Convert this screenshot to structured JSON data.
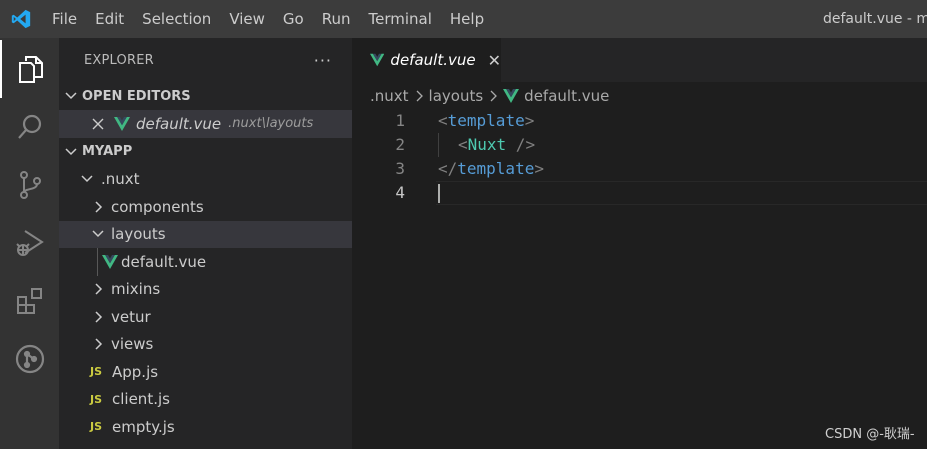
{
  "titlebar": {
    "menu": [
      "File",
      "Edit",
      "Selection",
      "View",
      "Go",
      "Run",
      "Terminal",
      "Help"
    ],
    "window_title": "default.vue - my"
  },
  "activitybar": {
    "icons": [
      "explorer-icon",
      "search-icon",
      "source-control-icon",
      "run-debug-icon",
      "extensions-icon",
      "git-graph-icon"
    ]
  },
  "sidebar": {
    "title": "EXPLORER",
    "more": "···",
    "open_editors": {
      "header": "OPEN EDITORS",
      "items": [
        {
          "name": "default.vue",
          "path": ".nuxt\\layouts"
        }
      ]
    },
    "project": {
      "header": "MYAPP",
      "tree": [
        {
          "label": ".nuxt",
          "kind": "folder-open",
          "level": 1
        },
        {
          "label": "components",
          "kind": "folder",
          "level": 2
        },
        {
          "label": "layouts",
          "kind": "folder-open",
          "level": 2
        },
        {
          "label": "default.vue",
          "kind": "vue",
          "level": 3
        },
        {
          "label": "mixins",
          "kind": "folder",
          "level": 2
        },
        {
          "label": "vetur",
          "kind": "folder",
          "level": 2
        },
        {
          "label": "views",
          "kind": "folder",
          "level": 2
        },
        {
          "label": "App.js",
          "kind": "js",
          "level": 2
        },
        {
          "label": "client.js",
          "kind": "js",
          "level": 2
        },
        {
          "label": "empty.js",
          "kind": "js",
          "level": 2
        }
      ],
      "js_badge": "JS"
    }
  },
  "editor": {
    "tab": {
      "label": "default.vue",
      "close": "✕"
    },
    "breadcrumb": [
      ".nuxt",
      "layouts",
      "default.vue"
    ],
    "lines": [
      {
        "no": "1",
        "open": "<",
        "tag": "template",
        "close": ">"
      },
      {
        "no": "2",
        "open": "<",
        "tag": "Nuxt",
        "close": " />"
      },
      {
        "no": "3",
        "open": "</",
        "tag": "template",
        "close": ">"
      },
      {
        "no": "4"
      }
    ]
  },
  "watermark": "CSDN @-耿瑞-",
  "colors": {
    "vue_green": "#41b883",
    "vue_dark": "#35495e",
    "accent_blue": "#569cd6",
    "js_yellow": "#cbcb41"
  }
}
